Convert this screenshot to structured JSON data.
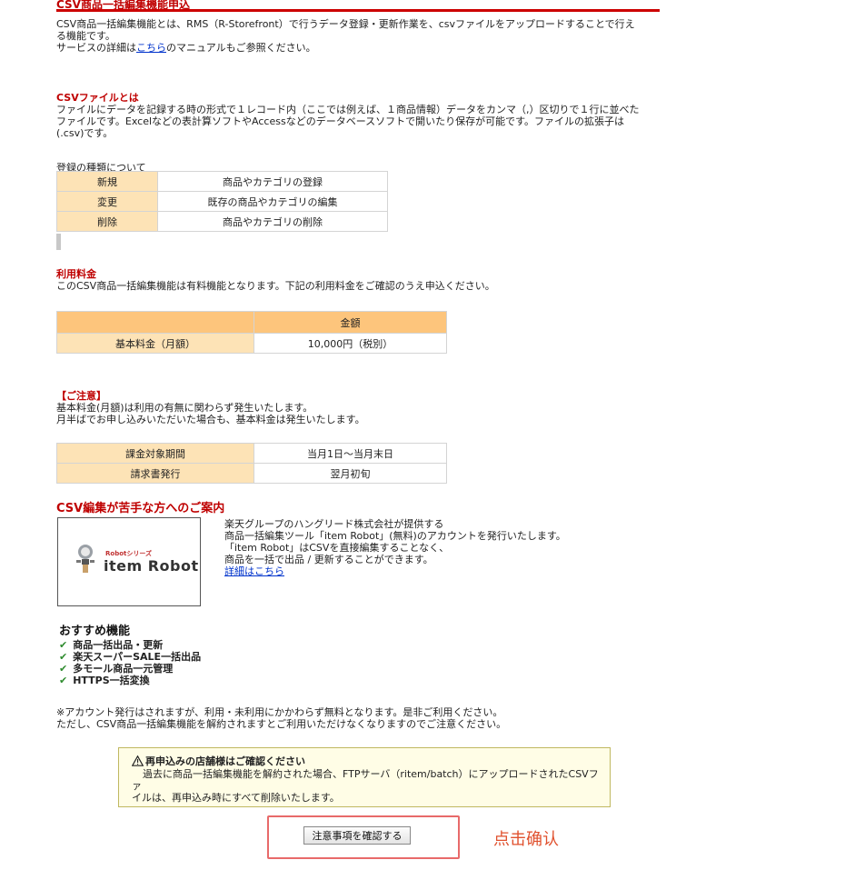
{
  "header": {
    "cut_title": "CSV商品一括編集機能申込"
  },
  "intro": {
    "line1": "CSV商品一括編集機能とは、RMS（R-Storefront）で行うデータ登録・更新作業を、csvファイルをアップロードすることで行え",
    "line2": "る機能です。",
    "line3_pre": "サービスの詳細は",
    "line3_link": "こちら",
    "line3_post": "のマニュアルもご参照ください。"
  },
  "csv_section": {
    "heading": "CSVファイルとは",
    "line1": "ファイルにデータを記録する時の形式で１レコード内（ここでは例えば、１商品情報）データをカンマ（,）区切りで１行に並べた",
    "line2": "ファイルです。Excelなどの表計算ソフトやAccessなどのデータベースソフトで開いたり保存が可能です。ファイルの拡張子は",
    "line3": "(.csv)です。"
  },
  "registration_types": {
    "caption": "登録の種類について",
    "rows": [
      {
        "type": "新規",
        "desc": "商品やカテゴリの登録"
      },
      {
        "type": "変更",
        "desc": "既存の商品やカテゴリの編集"
      },
      {
        "type": "削除",
        "desc": "商品やカテゴリの削除"
      }
    ]
  },
  "fee": {
    "heading": "利用料金",
    "text": "このCSV商品一括編集機能は有料機能となります。下記の利用料金をご確認のうえ申込ください。",
    "column_header": "金額",
    "row_label": "基本料金（月額）",
    "row_value": "10,000円（税別）"
  },
  "notice": {
    "heading": "【ご注意】",
    "line1": "基本料金(月額)は利用の有無に関わらず発生いたします。",
    "line2": "月半ばでお申し込みいただいた場合も、基本料金は発生いたします。",
    "rows": [
      {
        "label": "課金対象期間",
        "value": "当月1日～当月末日"
      },
      {
        "label": "請求書発行",
        "value": "翌月初旬"
      }
    ]
  },
  "csv_help": {
    "heading": "CSV編集が苦手な方へのご案内",
    "logo_series": "Robotシリーズ",
    "logo_name": "item Robot",
    "line1": "楽天グループのハングリード株式会社が提供する",
    "line2": "商品一括編集ツール「item Robot」(無料)のアカウントを発行いたします。",
    "line3": "「item Robot」はCSVを直接編集することなく、",
    "line4": "商品を一括で出品 / 更新することができます。",
    "detail_link": "詳細はこちら"
  },
  "recommended": {
    "heading": "おすすめ機能",
    "items": [
      "商品一括出品・更新",
      "楽天スーパーSALE一括出品",
      "多モール商品一元管理",
      "HTTPS一括変換"
    ]
  },
  "account_note": {
    "line1": "※アカウント発行はされますが、利用・未利用にかかわらず無料となります。是非ご利用ください。",
    "line2": "ただし、CSV商品一括編集機能を解約されますとご利用いただけなくなりますのでご注意ください。"
  },
  "warning": {
    "title": "再申込みの店舗様はご確認ください",
    "line1": "過去に商品一括編集機能を解約された場合、FTPサーバ（ritem/batch）にアップロードされたCSVファ",
    "line2": "イルは、再申込み時にすべて削除いたします。"
  },
  "confirm_button": "注意事項を確認する",
  "annotation": "点击确认",
  "colors": {
    "accent_red": "#bf0000",
    "table_label_bg": "#fde3b6",
    "table_header_bg": "#fdc57c",
    "annotation": "#e0502d",
    "check": "#2e8b2e"
  }
}
